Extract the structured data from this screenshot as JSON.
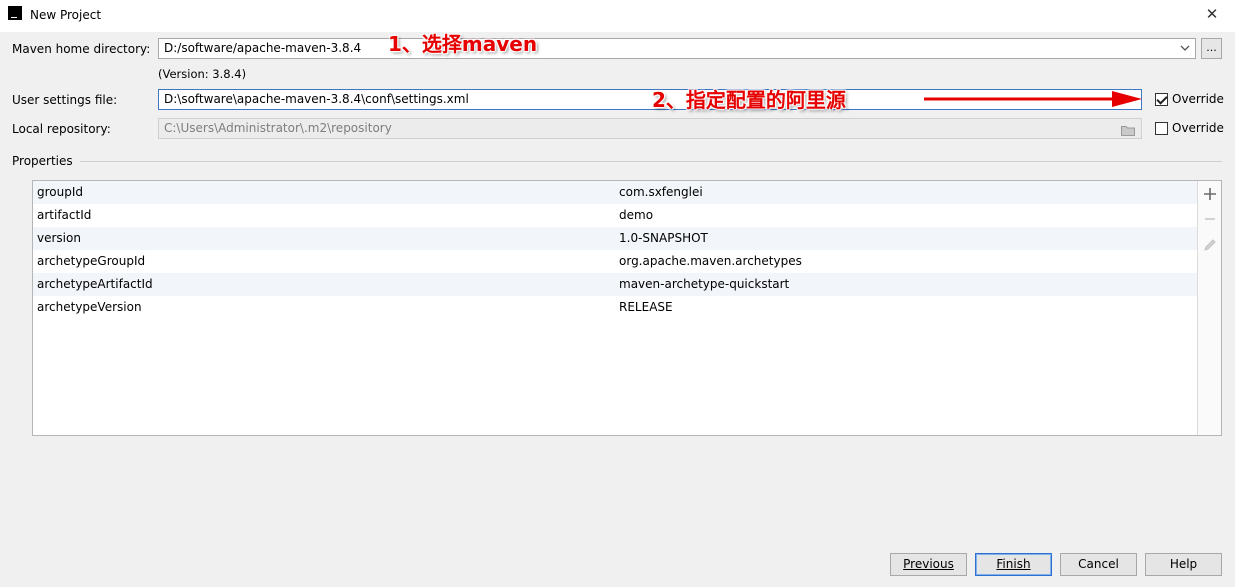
{
  "window": {
    "title": "New Project",
    "close_glyph": "✕",
    "app_icon_text": "IJ"
  },
  "form": {
    "maven_home": {
      "label": "Maven home directory:",
      "value": "D:/software/apache-maven-3.8.4",
      "version_note": "(Version: 3.8.4)",
      "browse_label": "..."
    },
    "user_settings": {
      "label": "User settings file:",
      "value": "D:\\software\\apache-maven-3.8.4\\conf\\settings.xml",
      "override_label": "Override",
      "override_checked": true
    },
    "local_repository": {
      "label": "Local repository:",
      "value": "C:\\Users\\Administrator\\.m2\\repository",
      "override_label": "Override",
      "override_checked": false
    }
  },
  "annotations": {
    "step1": "1、选择maven",
    "step2": "2、指定配置的阿里源",
    "arrow_color": "#e60000"
  },
  "properties": {
    "section_label": "Properties",
    "rows": [
      {
        "key": "groupId",
        "value": "com.sxfenglei"
      },
      {
        "key": "artifactId",
        "value": "demo"
      },
      {
        "key": "version",
        "value": "1.0-SNAPSHOT"
      },
      {
        "key": "archetypeGroupId",
        "value": "org.apache.maven.archetypes"
      },
      {
        "key": "archetypeArtifactId",
        "value": "maven-archetype-quickstart"
      },
      {
        "key": "archetypeVersion",
        "value": "RELEASE"
      }
    ],
    "tools": [
      "add-icon",
      "remove-icon",
      "edit-icon"
    ]
  },
  "buttons": {
    "previous": "Previous",
    "finish": "Finish",
    "cancel": "Cancel",
    "help": "Help"
  }
}
